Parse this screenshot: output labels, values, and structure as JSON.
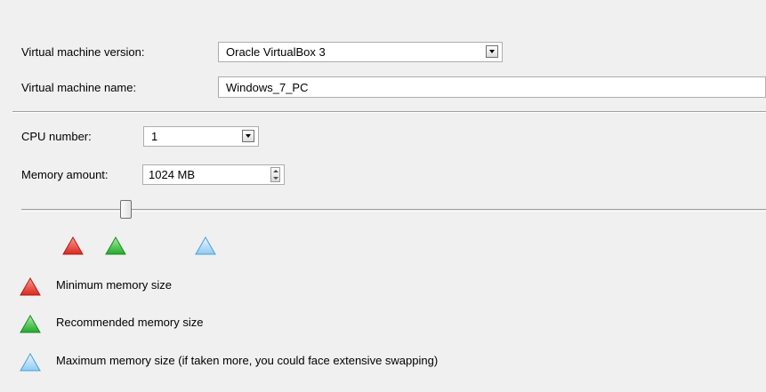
{
  "form": {
    "vm_version": {
      "label": "Virtual machine version:",
      "value": "Oracle VirtualBox 3"
    },
    "vm_name": {
      "label": "Virtual machine name:",
      "value": "Windows_7_PC"
    },
    "cpu": {
      "label": "CPU number:",
      "value": "1"
    },
    "memory": {
      "label": "Memory amount:",
      "value": "1024 MB"
    }
  },
  "memory_slider": {
    "position_fraction": 0.14,
    "markers": [
      {
        "name": "minimum",
        "icon": "red-triangle-icon",
        "color": "#e0302a"
      },
      {
        "name": "recommended",
        "icon": "green-triangle-icon",
        "color": "#29b02b"
      },
      {
        "name": "maximum",
        "icon": "blue-triangle-icon",
        "color": "#5aaee8"
      }
    ]
  },
  "legend": {
    "minimum": "Minimum memory size",
    "recommended": "Recommended memory size",
    "maximum": "Maximum memory size (if taken more, you could face extensive swapping)"
  }
}
